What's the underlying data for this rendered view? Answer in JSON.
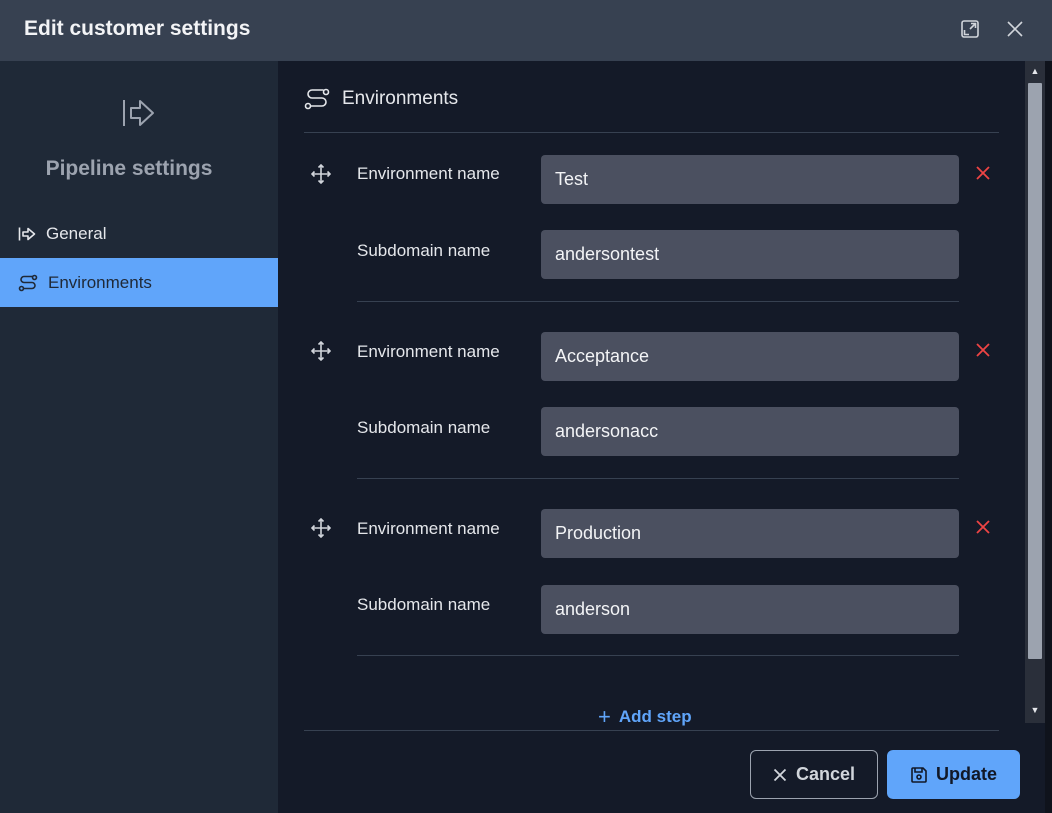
{
  "dialog": {
    "title": "Edit customer settings",
    "controls": [
      "expand-icon",
      "close-icon"
    ]
  },
  "sidebar": {
    "title": "Pipeline settings",
    "items": [
      {
        "label": "General",
        "icon": "arrow-right-from-bar-icon",
        "active": false
      },
      {
        "label": "Environments",
        "icon": "route-icon",
        "active": true
      }
    ]
  },
  "section": {
    "title": "Environments"
  },
  "environments": [
    {
      "env_label": "Environment name",
      "env_value": "Test",
      "sub_label": "Subdomain name",
      "sub_value": "andersontest"
    },
    {
      "env_label": "Environment name",
      "env_value": "Acceptance",
      "sub_label": "Subdomain name",
      "sub_value": "andersonacc"
    },
    {
      "env_label": "Environment name",
      "env_value": "Production",
      "sub_label": "Subdomain name",
      "sub_value": "anderson"
    }
  ],
  "add_step": {
    "label": "Add step"
  },
  "footer": {
    "cancel_label": "Cancel",
    "update_label": "Update"
  },
  "colors": {
    "accent": "#60a5fa",
    "danger": "#ef4444",
    "titlebar": "#374151",
    "sidebar": "#1f2937",
    "main": "#141a28",
    "field": "#4b5060"
  }
}
